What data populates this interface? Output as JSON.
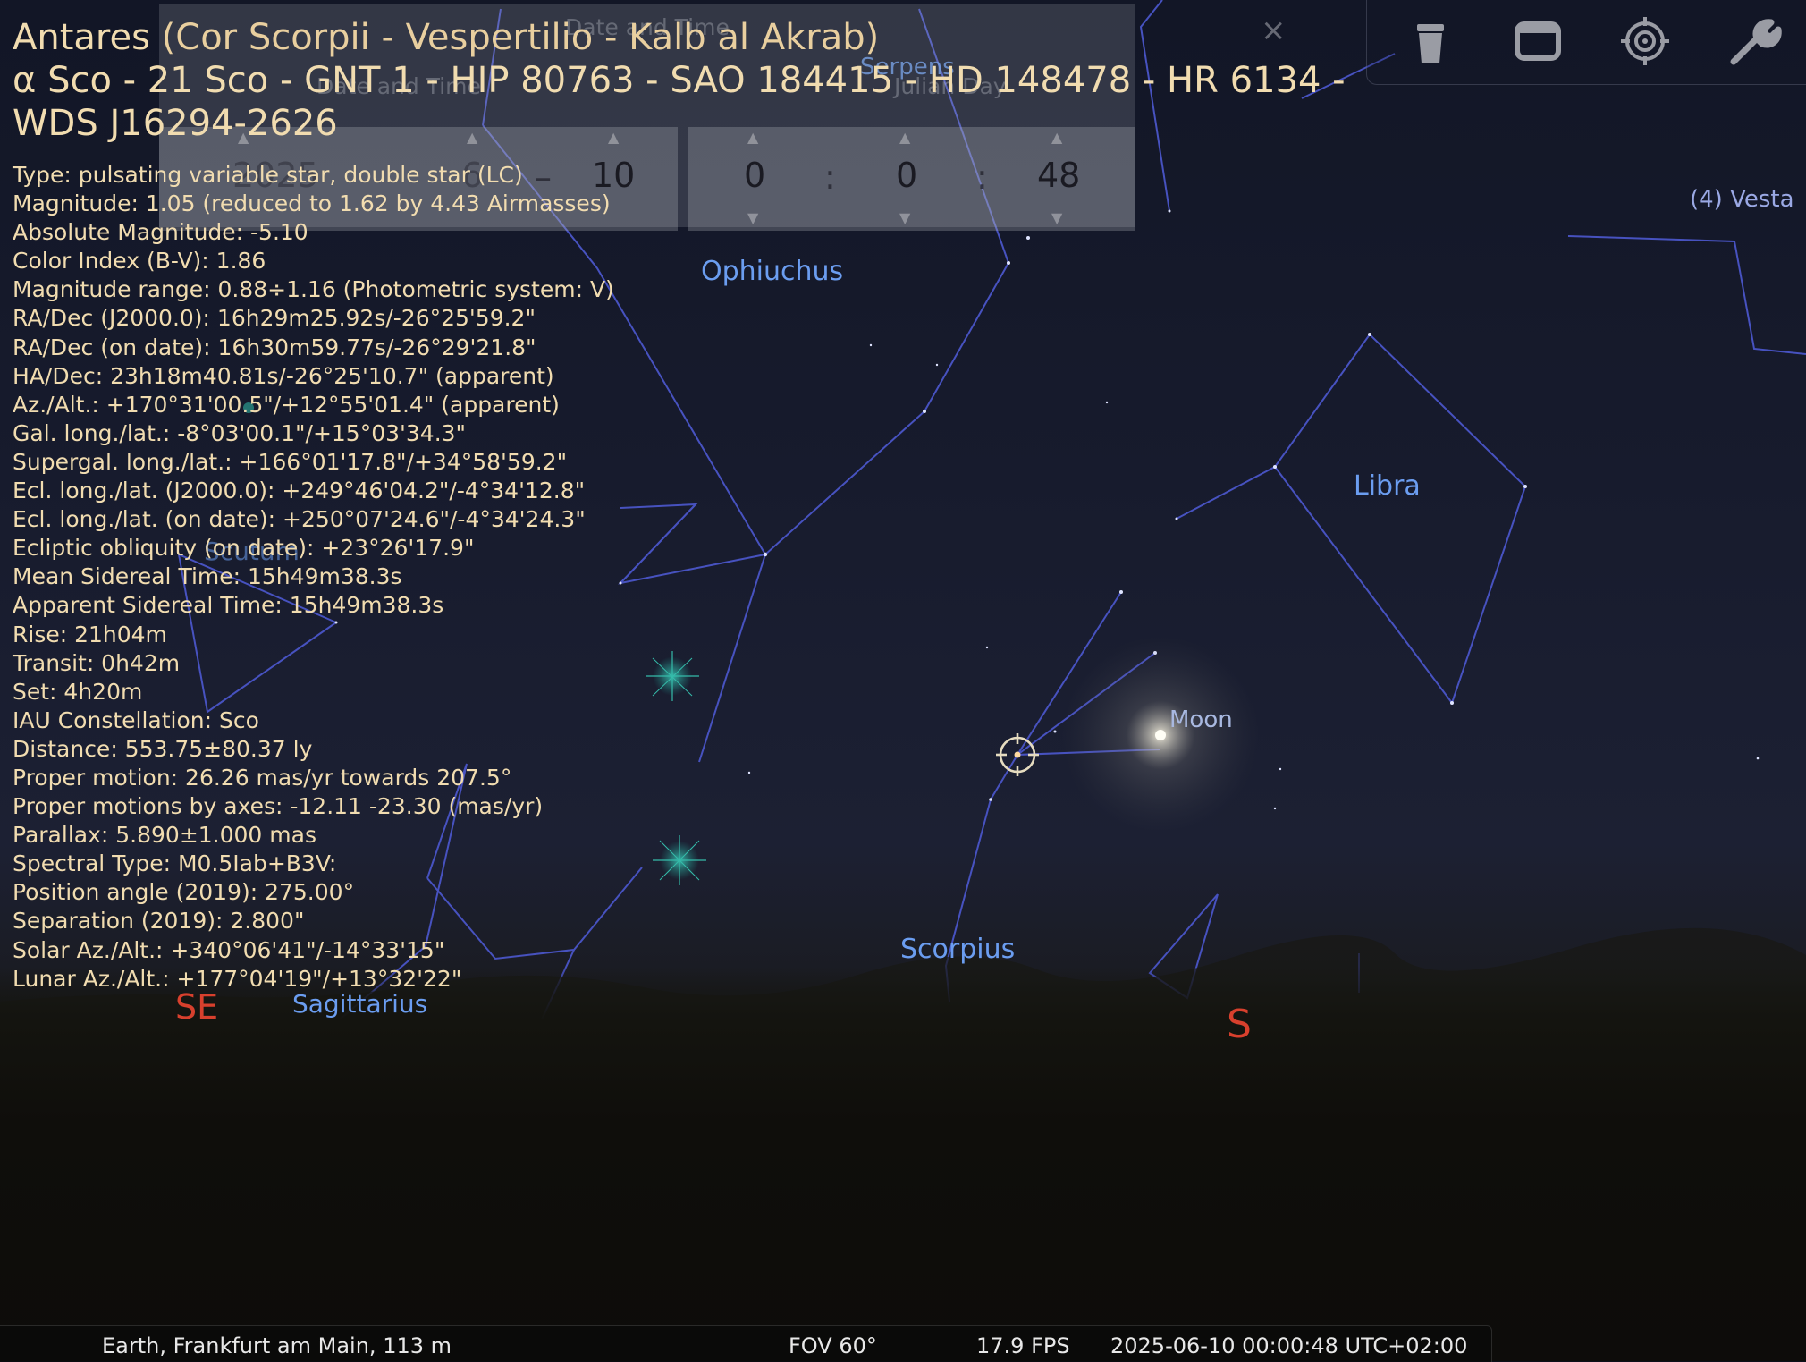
{
  "object": {
    "name": "Antares",
    "alt_names": "(Cor Scorpii - Vespertilio - Kalb al Akrab)",
    "designations_line1": "α Sco - 21 Sco - GNT 1 - HIP 80763 - SAO 184415 - HD 148478 - HR 6134 -",
    "designations_line2": "WDS J16294-2626",
    "info": [
      "Type: pulsating variable star, double star (LC)",
      "Magnitude: 1.05 (reduced to 1.62 by 4.43 Airmasses)",
      "Absolute Magnitude: -5.10",
      "Color Index (B-V): 1.86",
      "Magnitude range: 0.88÷1.16 (Photometric system: V)",
      "RA/Dec (J2000.0): 16h29m25.92s/-26°25'59.2\"",
      "RA/Dec (on date): 16h30m59.77s/-26°29'21.8\"",
      "HA/Dec: 23h18m40.81s/-26°25'10.7\" (apparent)",
      "Az./Alt.: +170°31'00.5\"/+12°55'01.4\" (apparent)",
      "Gal. long./lat.: -8°03'00.1\"/+15°03'34.3\"",
      "Supergal. long./lat.: +166°01'17.8\"/+34°58'59.2\"",
      "Ecl. long./lat. (J2000.0): +249°46'04.2\"/-4°34'12.8\"",
      "Ecl. long./lat. (on date): +250°07'24.6\"/-4°34'24.3\"",
      "Ecliptic obliquity (on date): +23°26'17.9\"",
      "Mean Sidereal Time: 15h49m38.3s",
      "Apparent Sidereal Time: 15h49m38.3s",
      "Rise: 21h04m",
      "Transit: 0h42m",
      "Set: 4h20m",
      "IAU Constellation: Sco",
      "Distance: 553.75±80.37 ly",
      "Proper motion: 26.26 mas/yr towards 207.5°",
      "Proper motions by axes: -12.11 -23.30 (mas/yr)",
      "Parallax: 5.890±1.000 mas",
      "Spectral Type: M0.5Iab+B3V:",
      "Position angle (2019): 275.00°",
      "Separation (2019): 2.800\"",
      "Solar Az./Alt.: +340°06'41\"/-14°33'15\"",
      "Lunar Az./Alt.: +177°04'19\"/+13°32'22\""
    ]
  },
  "datetime_dialog": {
    "title": "Date and Time",
    "date_label": "Date and Time",
    "julian_label": "Julian Day",
    "year": "2025",
    "month": "6",
    "day": "10",
    "hour": "0",
    "minute": "0",
    "second": "48",
    "date_sep": "–",
    "time_sep": ":",
    "close": "×",
    "arrow_up": "▲",
    "arrow_down": "▼"
  },
  "sky_labels": {
    "ophiuchus": "Ophiuchus",
    "serpens": "Serpens",
    "libra": "Libra",
    "scorpius": "Scorpius",
    "scutum": "Scutum",
    "sagittarius": "Sagittarius",
    "moon": "Moon",
    "vesta": "(4) Vesta",
    "cardinal_se": "SE",
    "cardinal_s": "S"
  },
  "toolbar": {
    "icons": [
      "trash-icon",
      "window-icon",
      "target-icon",
      "wrench-icon"
    ]
  },
  "status": {
    "location": "Earth, Frankfurt am Main, 113 m",
    "fov": "FOV 60°",
    "fps": "17.9 FPS",
    "datetime": "2025-06-10 00:00:48 UTC+02:00"
  },
  "colors": {
    "constellation_line": "#4a55c8",
    "label_blue": "#6b9df0",
    "cardinal_red": "#d8402d",
    "info_text": "#f1dcb0"
  }
}
